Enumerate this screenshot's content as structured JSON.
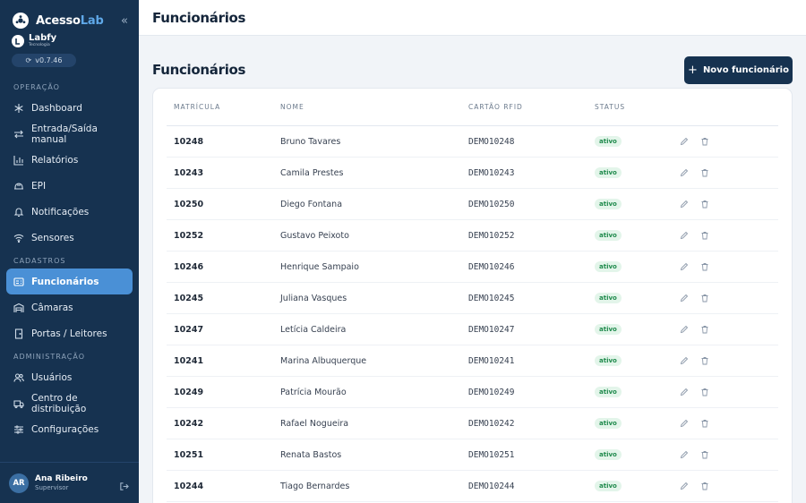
{
  "sidebar": {
    "brand_prefix": "Acesso",
    "brand_accent": "Lab",
    "sub_brand": "Labfy",
    "sub_tagline": "Tecnologia",
    "version": "v0.7.46",
    "sections": [
      {
        "title": "Operação",
        "items": [
          {
            "label": "Dashboard",
            "icon": "snowflake-icon"
          },
          {
            "label": "Entrada/Saída manual",
            "icon": "swap-arrows-icon"
          },
          {
            "label": "Relatórios",
            "icon": "bar-chart-icon"
          },
          {
            "label": "EPI",
            "icon": "helmet-icon"
          },
          {
            "label": "Notificações",
            "icon": "bell-icon"
          },
          {
            "label": "Sensores",
            "icon": "wifi-icon"
          }
        ]
      },
      {
        "title": "Cadastros",
        "items": [
          {
            "label": "Funcionários",
            "icon": "id-card-icon",
            "active": true
          },
          {
            "label": "Câmaras",
            "icon": "warehouse-icon"
          },
          {
            "label": "Portas / Leitores",
            "icon": "door-icon"
          }
        ]
      },
      {
        "title": "Administração",
        "items": [
          {
            "label": "Usuários",
            "icon": "users-icon"
          },
          {
            "label": "Centro de distribuição",
            "icon": "truck-icon"
          },
          {
            "label": "Configurações",
            "icon": "sliders-icon"
          }
        ]
      }
    ],
    "user": {
      "initials": "AR",
      "name": "Ana Ribeiro",
      "role": "Supervisor"
    }
  },
  "topbar": {
    "title": "Funcionários"
  },
  "page": {
    "title": "Funcionários",
    "new_button": "Novo funcionário"
  },
  "table": {
    "columns": [
      "Matrícula",
      "Nome",
      "Cartão RFID",
      "Status"
    ],
    "rows": [
      {
        "matricula": "10248",
        "nome": "Bruno Tavares",
        "rfid": "DEMO10248",
        "status": "ativo"
      },
      {
        "matricula": "10243",
        "nome": "Camila Prestes",
        "rfid": "DEMO10243",
        "status": "ativo"
      },
      {
        "matricula": "10250",
        "nome": "Diego Fontana",
        "rfid": "DEMO10250",
        "status": "ativo"
      },
      {
        "matricula": "10252",
        "nome": "Gustavo Peixoto",
        "rfid": "DEMO10252",
        "status": "ativo"
      },
      {
        "matricula": "10246",
        "nome": "Henrique Sampaio",
        "rfid": "DEMO10246",
        "status": "ativo"
      },
      {
        "matricula": "10245",
        "nome": "Juliana Vasques",
        "rfid": "DEMO10245",
        "status": "ativo"
      },
      {
        "matricula": "10247",
        "nome": "Letícia Caldeira",
        "rfid": "DEMO10247",
        "status": "ativo"
      },
      {
        "matricula": "10241",
        "nome": "Marina Albuquerque",
        "rfid": "DEMO10241",
        "status": "ativo"
      },
      {
        "matricula": "10249",
        "nome": "Patrícia Mourão",
        "rfid": "DEMO10249",
        "status": "ativo"
      },
      {
        "matricula": "10242",
        "nome": "Rafael Nogueira",
        "rfid": "DEMO10242",
        "status": "ativo"
      },
      {
        "matricula": "10251",
        "nome": "Renata Bastos",
        "rfid": "DEMO10251",
        "status": "ativo"
      },
      {
        "matricula": "10244",
        "nome": "Tiago Bernardes",
        "rfid": "DEMO10244",
        "status": "ativo"
      }
    ]
  },
  "colors": {
    "sidebar_bg": "#163250",
    "accent": "#4a90d6",
    "status_green": "#1f8a4c"
  }
}
